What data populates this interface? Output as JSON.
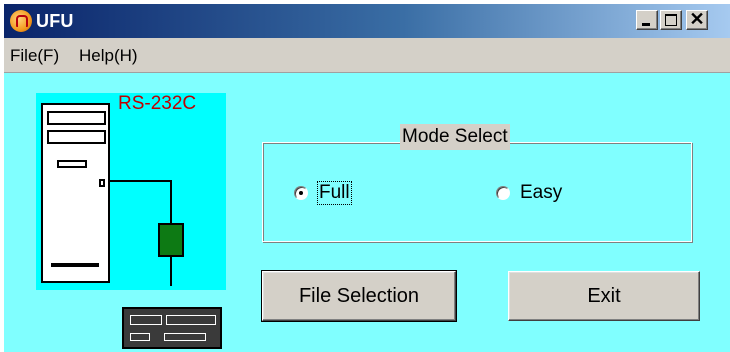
{
  "window": {
    "title": "UFU",
    "app_icon": "app-icon"
  },
  "title_buttons": {
    "minimize": "minimize-icon",
    "maximize": "maximize-icon",
    "close": "close-icon",
    "close_glyph": "✕"
  },
  "menu": {
    "file": "File(F)",
    "help": "Help(H)"
  },
  "illustration": {
    "label": "RS-232C"
  },
  "mode_select": {
    "title": "Mode Select",
    "options": [
      {
        "label": "Full",
        "checked": true
      },
      {
        "label": "Easy",
        "checked": false
      }
    ]
  },
  "buttons": {
    "file_selection": "File Selection",
    "exit": "Exit"
  },
  "colors": {
    "client_bg": "#80ffff",
    "illustration_bg": "#00ffff",
    "label_red": "#c00000",
    "converter_green": "#0d7a14"
  }
}
